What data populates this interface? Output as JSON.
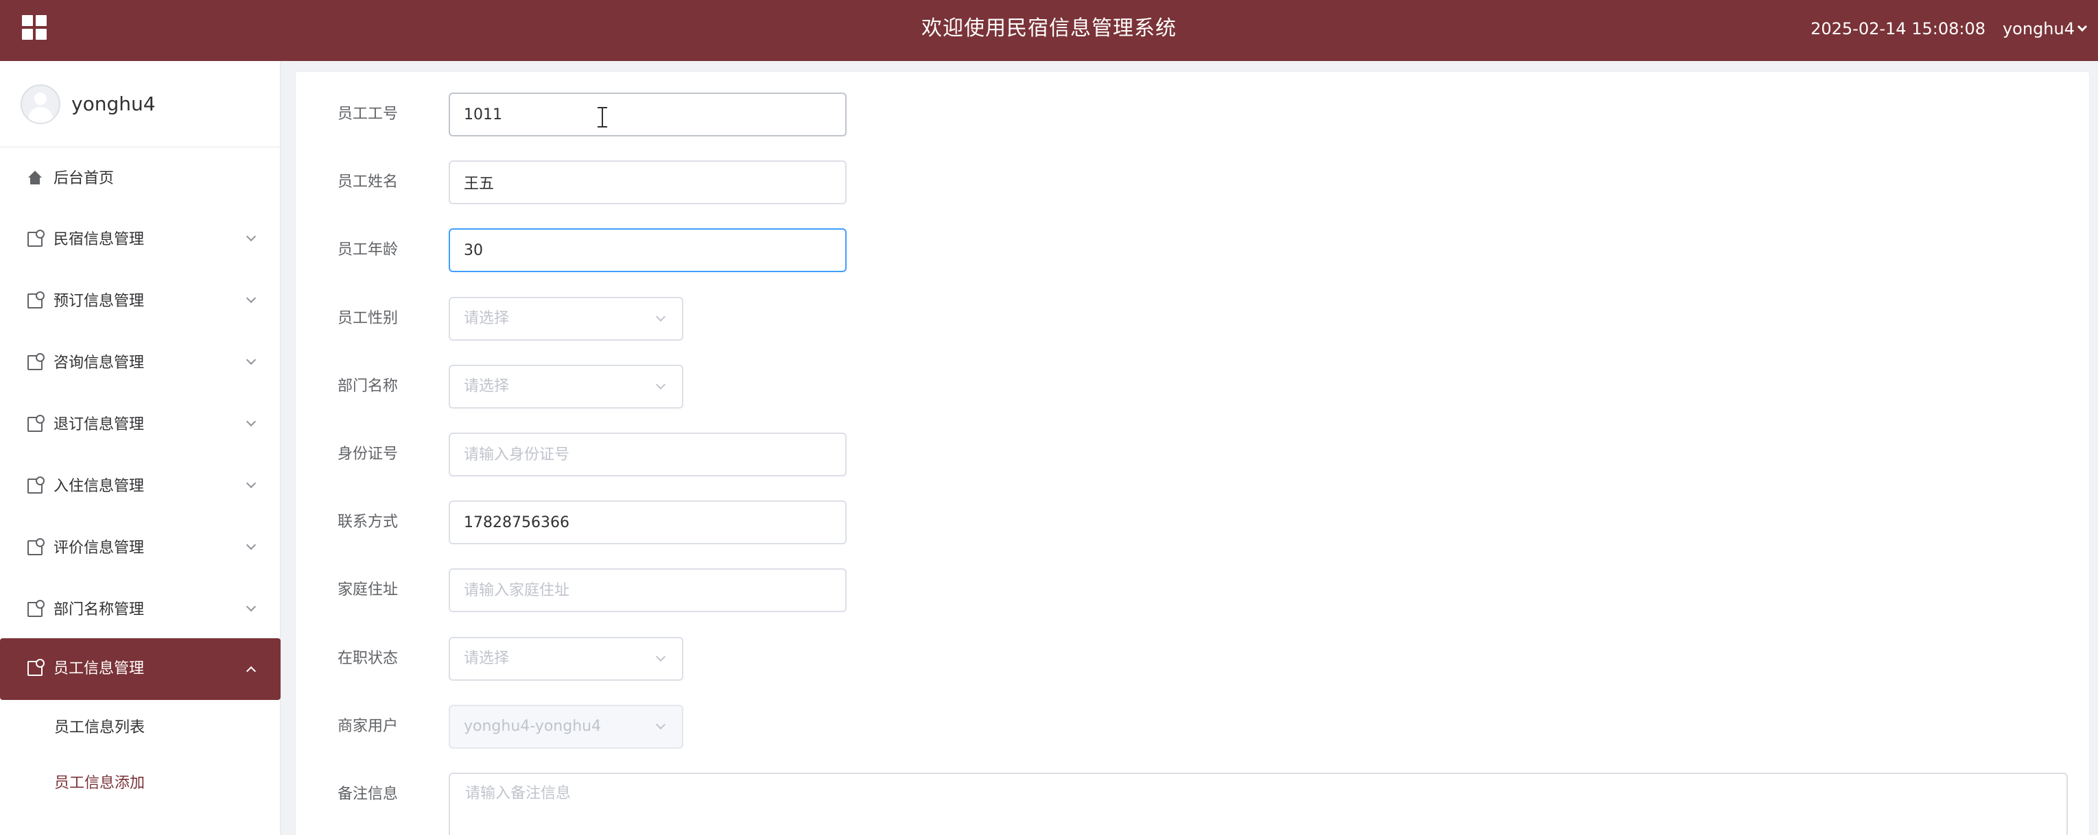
{
  "header": {
    "title": "欢迎使用民宿信息管理系统",
    "datetime": "2025-02-14 15:08:08",
    "username": "yonghu4"
  },
  "sidebar": {
    "profile_name": "yonghu4",
    "home_label": "后台首页",
    "menus": [
      {
        "label": "民宿信息管理"
      },
      {
        "label": "预订信息管理"
      },
      {
        "label": "咨询信息管理"
      },
      {
        "label": "退订信息管理"
      },
      {
        "label": "入住信息管理"
      },
      {
        "label": "评价信息管理"
      },
      {
        "label": "部门名称管理"
      },
      {
        "label": "员工信息管理"
      }
    ],
    "submenu": [
      {
        "label": "员工信息列表"
      },
      {
        "label": "员工信息添加"
      }
    ]
  },
  "form": {
    "employee_no": {
      "label": "员工工号",
      "value": "1011"
    },
    "employee_name": {
      "label": "员工姓名",
      "value": "王五"
    },
    "employee_age": {
      "label": "员工年龄",
      "value": "30"
    },
    "employee_gender": {
      "label": "员工性别",
      "placeholder": "请选择"
    },
    "department": {
      "label": "部门名称",
      "placeholder": "请选择"
    },
    "id_number": {
      "label": "身份证号",
      "placeholder": "请输入身份证号"
    },
    "contact": {
      "label": "联系方式",
      "value": "17828756366"
    },
    "address": {
      "label": "家庭住址",
      "placeholder": "请输入家庭住址"
    },
    "employment_status": {
      "label": "在职状态",
      "placeholder": "请选择"
    },
    "merchant_user": {
      "label": "商家用户",
      "value": "yonghu4-yonghu4"
    },
    "remarks": {
      "label": "备注信息",
      "placeholder": "请输入备注信息"
    }
  },
  "colors": {
    "brand": "#7a3338",
    "focus": "#409eff"
  }
}
